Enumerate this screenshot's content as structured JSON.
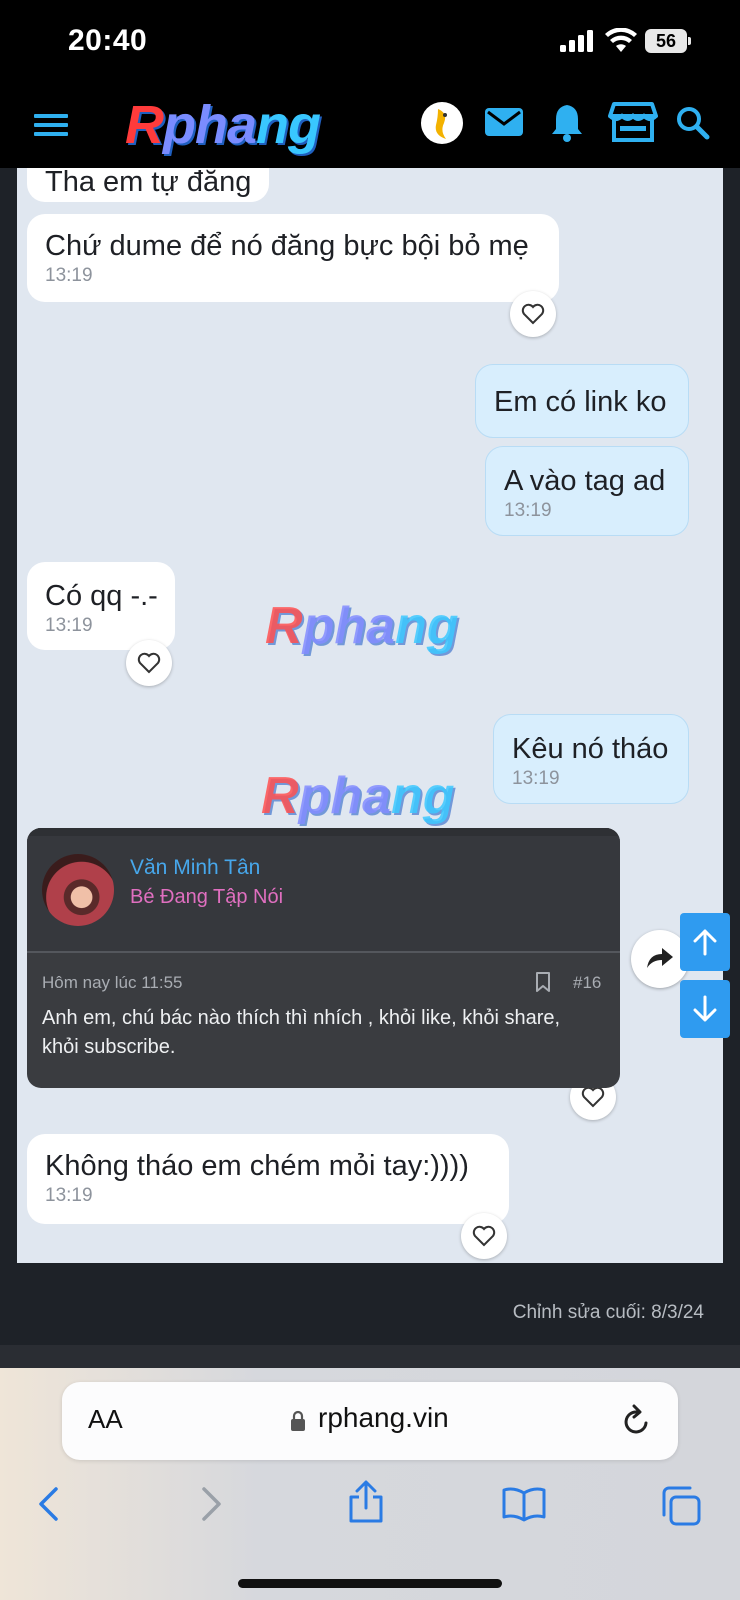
{
  "status_bar": {
    "time": "20:40",
    "battery": "56"
  },
  "header": {
    "logo_text": [
      "R",
      "pha",
      "ng"
    ],
    "icons": [
      "menu-icon",
      "avatar-icon",
      "mail-icon",
      "bell-icon",
      "store-icon",
      "search-icon"
    ]
  },
  "messages": [
    {
      "side": "in",
      "text": "Tha em tự đăng",
      "time": ""
    },
    {
      "side": "in",
      "text": "Chứ dume để nó đăng bực bội bỏ mẹ",
      "time": "13:19"
    },
    {
      "side": "out",
      "text": "Em có link ko",
      "time": ""
    },
    {
      "side": "out",
      "text": "A vào tag ad",
      "time": "13:19"
    },
    {
      "side": "in",
      "text": "Có qq -.-",
      "time": "13:19"
    },
    {
      "side": "out",
      "text": "Kêu nó tháo",
      "time": "13:19"
    },
    {
      "side": "in",
      "text": "Không tháo em chém mỏi tay:))))",
      "time": "13:19"
    }
  ],
  "watermark": [
    "R",
    "pha",
    "ng"
  ],
  "quote_card": {
    "username": "Văn Minh Tân",
    "user_title": "Bé Đang Tập Nói",
    "date": "Hôm nay lúc 11:55",
    "post_number": "#16",
    "body": "Anh em, chú bác nào thích thì nhích , khỏi like, khỏi share, khỏi subscribe."
  },
  "footer": {
    "edited": "Chỉnh sửa cuối: 8/3/24"
  },
  "browser": {
    "aa_label": "AA",
    "url": "rphang.vin"
  },
  "colors": {
    "accent": "#2f9bf0",
    "username": "#47a7eb",
    "user_title": "#e06fc0",
    "bubble_out": "#d8eefd"
  }
}
